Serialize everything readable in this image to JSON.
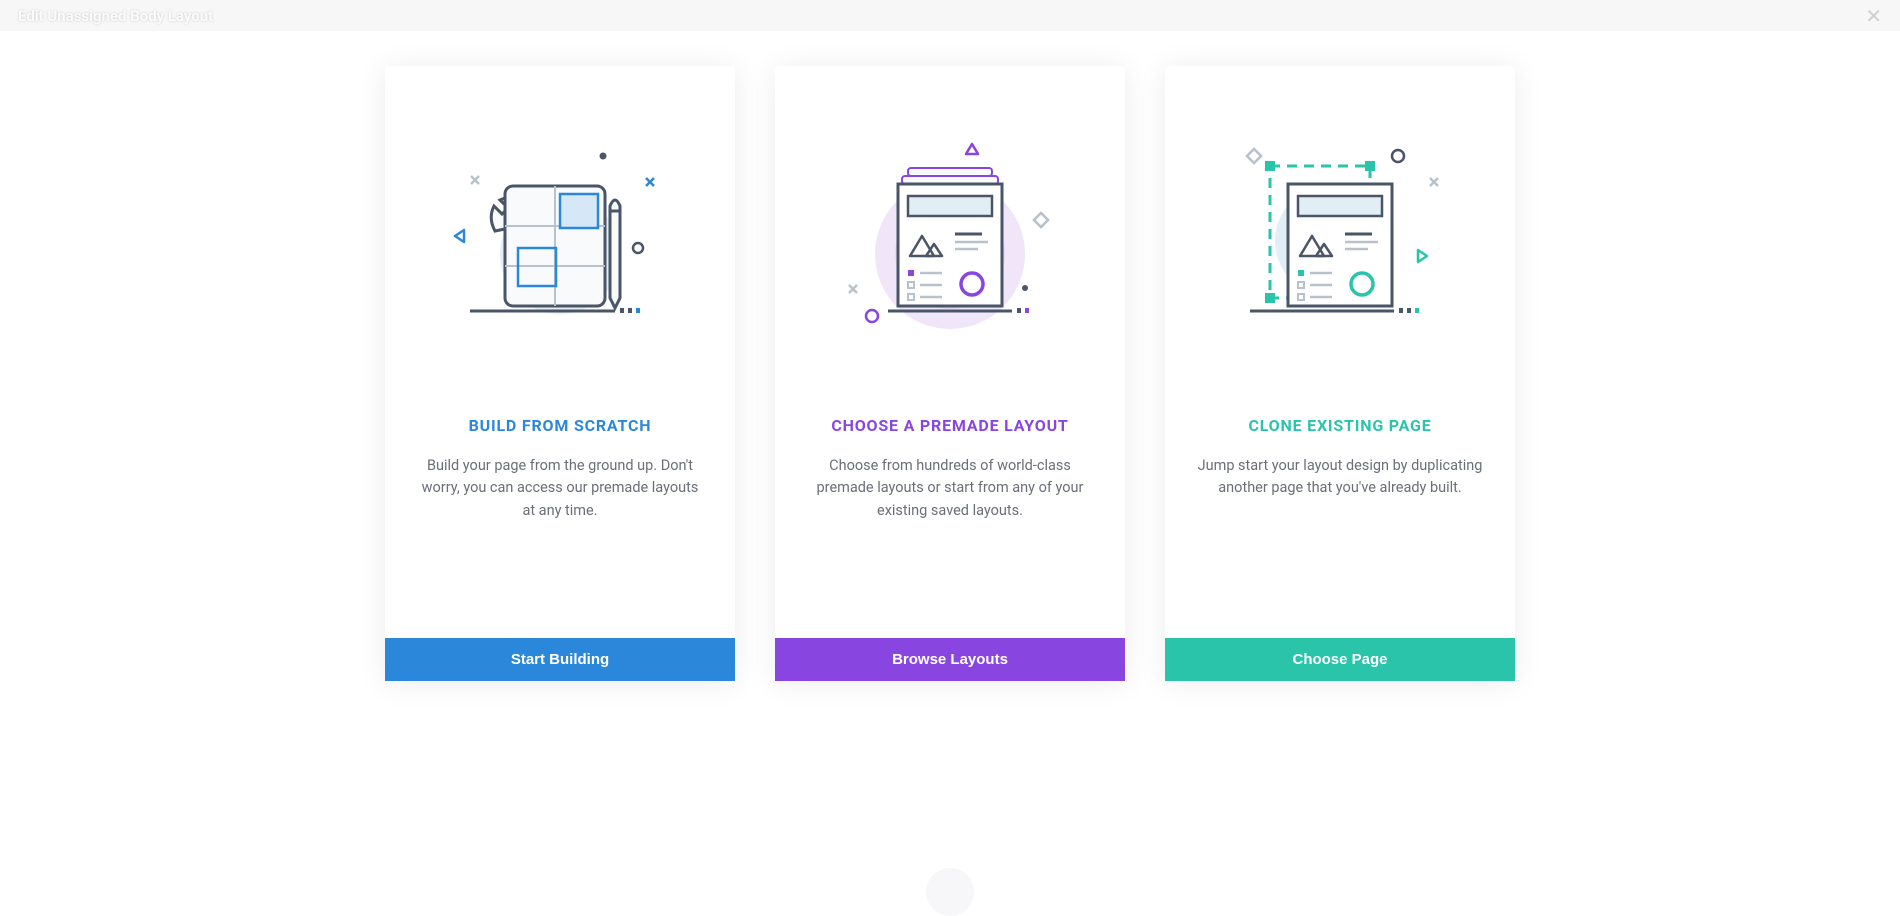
{
  "header": {
    "title": "Edit Unassigned Body Layout"
  },
  "cards": [
    {
      "heading": "BUILD FROM SCRATCH",
      "description": "Build your page from the ground up. Don't worry, you can access our premade layouts at any time.",
      "button": "Start Building",
      "color": "blue"
    },
    {
      "heading": "CHOOSE A PREMADE LAYOUT",
      "description": "Choose from hundreds of world-class premade layouts or start from any of your existing saved layouts.",
      "button": "Browse Layouts",
      "color": "purple"
    },
    {
      "heading": "CLONE EXISTING PAGE",
      "description": "Jump start your layout design by duplicating another page that you've already built.",
      "button": "Choose Page",
      "color": "teal"
    }
  ]
}
